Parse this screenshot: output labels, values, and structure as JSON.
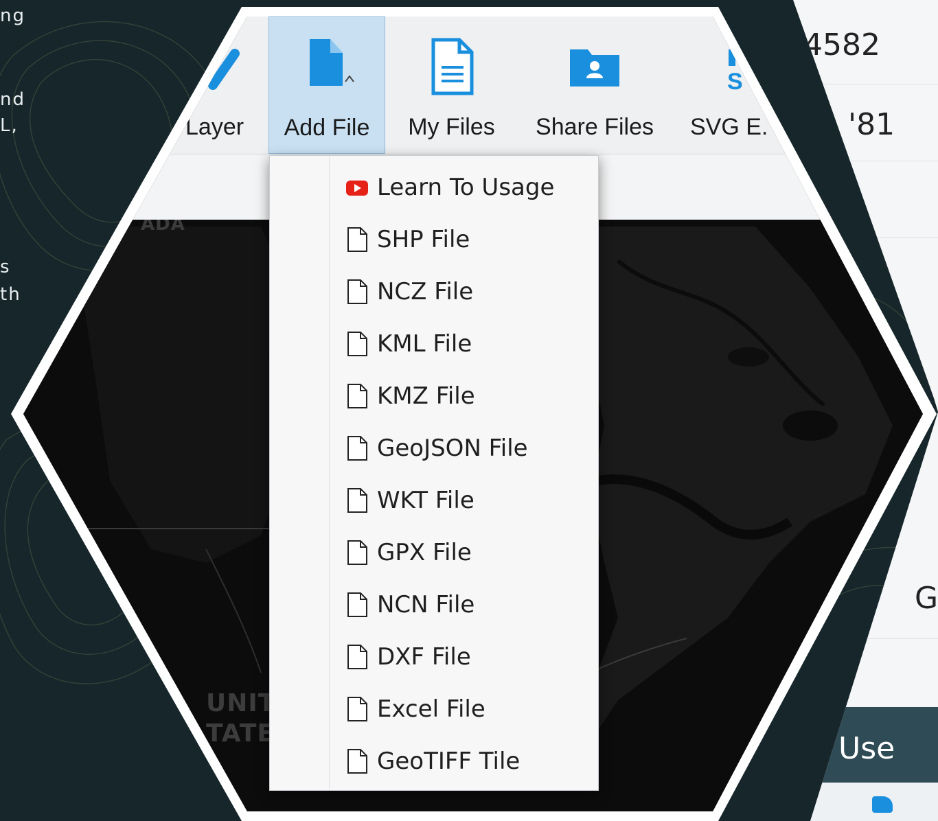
{
  "left_fragments": [
    "ng",
    "nd",
    "L,",
    "s",
    "th"
  ],
  "right_panel": {
    "row1": "4582",
    "row2": "'81",
    "row3": "G",
    "bar_text": "e Use"
  },
  "toolbar": {
    "buttons": [
      {
        "label": "Layer",
        "icon": "pencil-icon"
      },
      {
        "label": "Add File",
        "icon": "file-icon"
      },
      {
        "label": "My Files",
        "icon": "document-icon"
      },
      {
        "label": "Share Files",
        "icon": "shared-folder-icon"
      },
      {
        "label": "SVG E.",
        "icon": "svg-export-icon"
      }
    ]
  },
  "dropdown": {
    "items": [
      {
        "label": "Learn To Usage",
        "icon": "youtube-play-icon"
      },
      {
        "label": "SHP File",
        "icon": "file-outline-icon"
      },
      {
        "label": "NCZ File",
        "icon": "file-outline-icon"
      },
      {
        "label": "KML File",
        "icon": "file-outline-icon"
      },
      {
        "label": "KMZ File",
        "icon": "file-outline-icon"
      },
      {
        "label": "GeoJSON File",
        "icon": "file-outline-icon"
      },
      {
        "label": "WKT File",
        "icon": "file-outline-icon"
      },
      {
        "label": "GPX File",
        "icon": "file-outline-icon"
      },
      {
        "label": "NCN File",
        "icon": "file-outline-icon"
      },
      {
        "label": "DXF File",
        "icon": "file-outline-icon"
      },
      {
        "label": "Excel File",
        "icon": "file-outline-icon"
      },
      {
        "label": "GeoTIFF Tile",
        "icon": "file-outline-icon"
      }
    ]
  },
  "map": {
    "label_canada": "ADA",
    "label_us_1": "UNITE",
    "label_us_2": "TATE"
  },
  "colors": {
    "background": "#16262b",
    "accent_blue": "#1a8fdd",
    "active_tab": "#c9e0f3",
    "youtube_red": "#e62117"
  }
}
